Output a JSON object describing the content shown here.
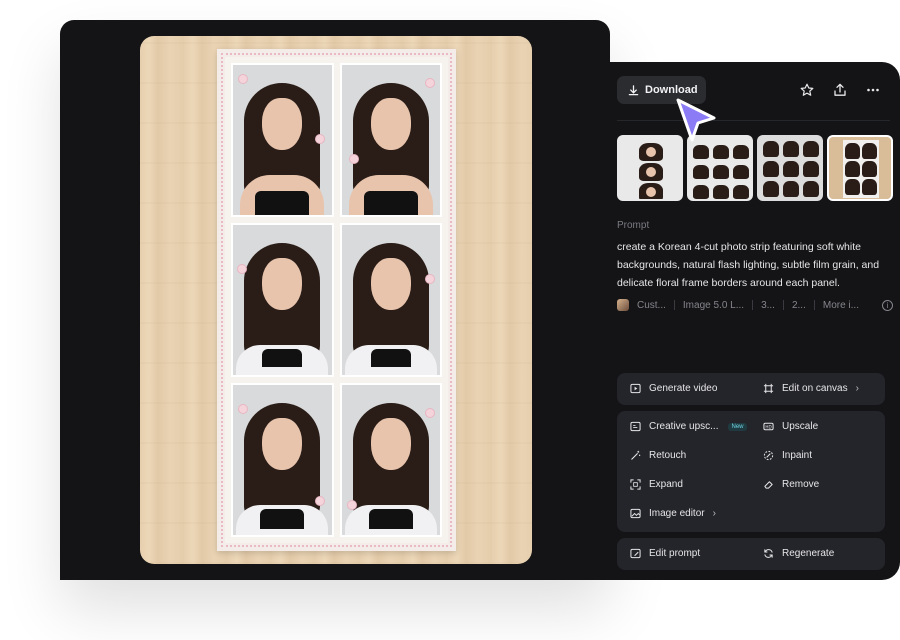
{
  "header": {
    "download_label": "Download",
    "icons": [
      "star-icon",
      "share-icon",
      "more-icon"
    ]
  },
  "thumbnails": [
    {
      "label": "thumb-1",
      "selected": false
    },
    {
      "label": "thumb-2",
      "selected": false
    },
    {
      "label": "thumb-3",
      "selected": false
    },
    {
      "label": "thumb-4",
      "selected": true
    }
  ],
  "prompt": {
    "label": "Prompt",
    "text": "create a Korean 4-cut photo strip featuring soft white backgrounds, natural flash lighting, subtle film grain, and delicate floral frame borders around each panel."
  },
  "meta": {
    "items": [
      "Cust...",
      "Image 5.0 L...",
      "3...",
      "2...",
      "More i..."
    ]
  },
  "actions": {
    "generate_video": "Generate video",
    "edit_on_canvas": "Edit on canvas",
    "creative_upscale": "Creative upsc...",
    "new_badge": "New",
    "upscale": "Upscale",
    "retouch": "Retouch",
    "inpaint": "Inpaint",
    "expand": "Expand",
    "remove": "Remove",
    "image_editor": "Image editor",
    "edit_prompt": "Edit prompt",
    "regenerate": "Regenerate"
  },
  "colors": {
    "panel_bg": "#141416",
    "card_bg": "#24252a",
    "accent_cursor": "#8b7cf6"
  }
}
